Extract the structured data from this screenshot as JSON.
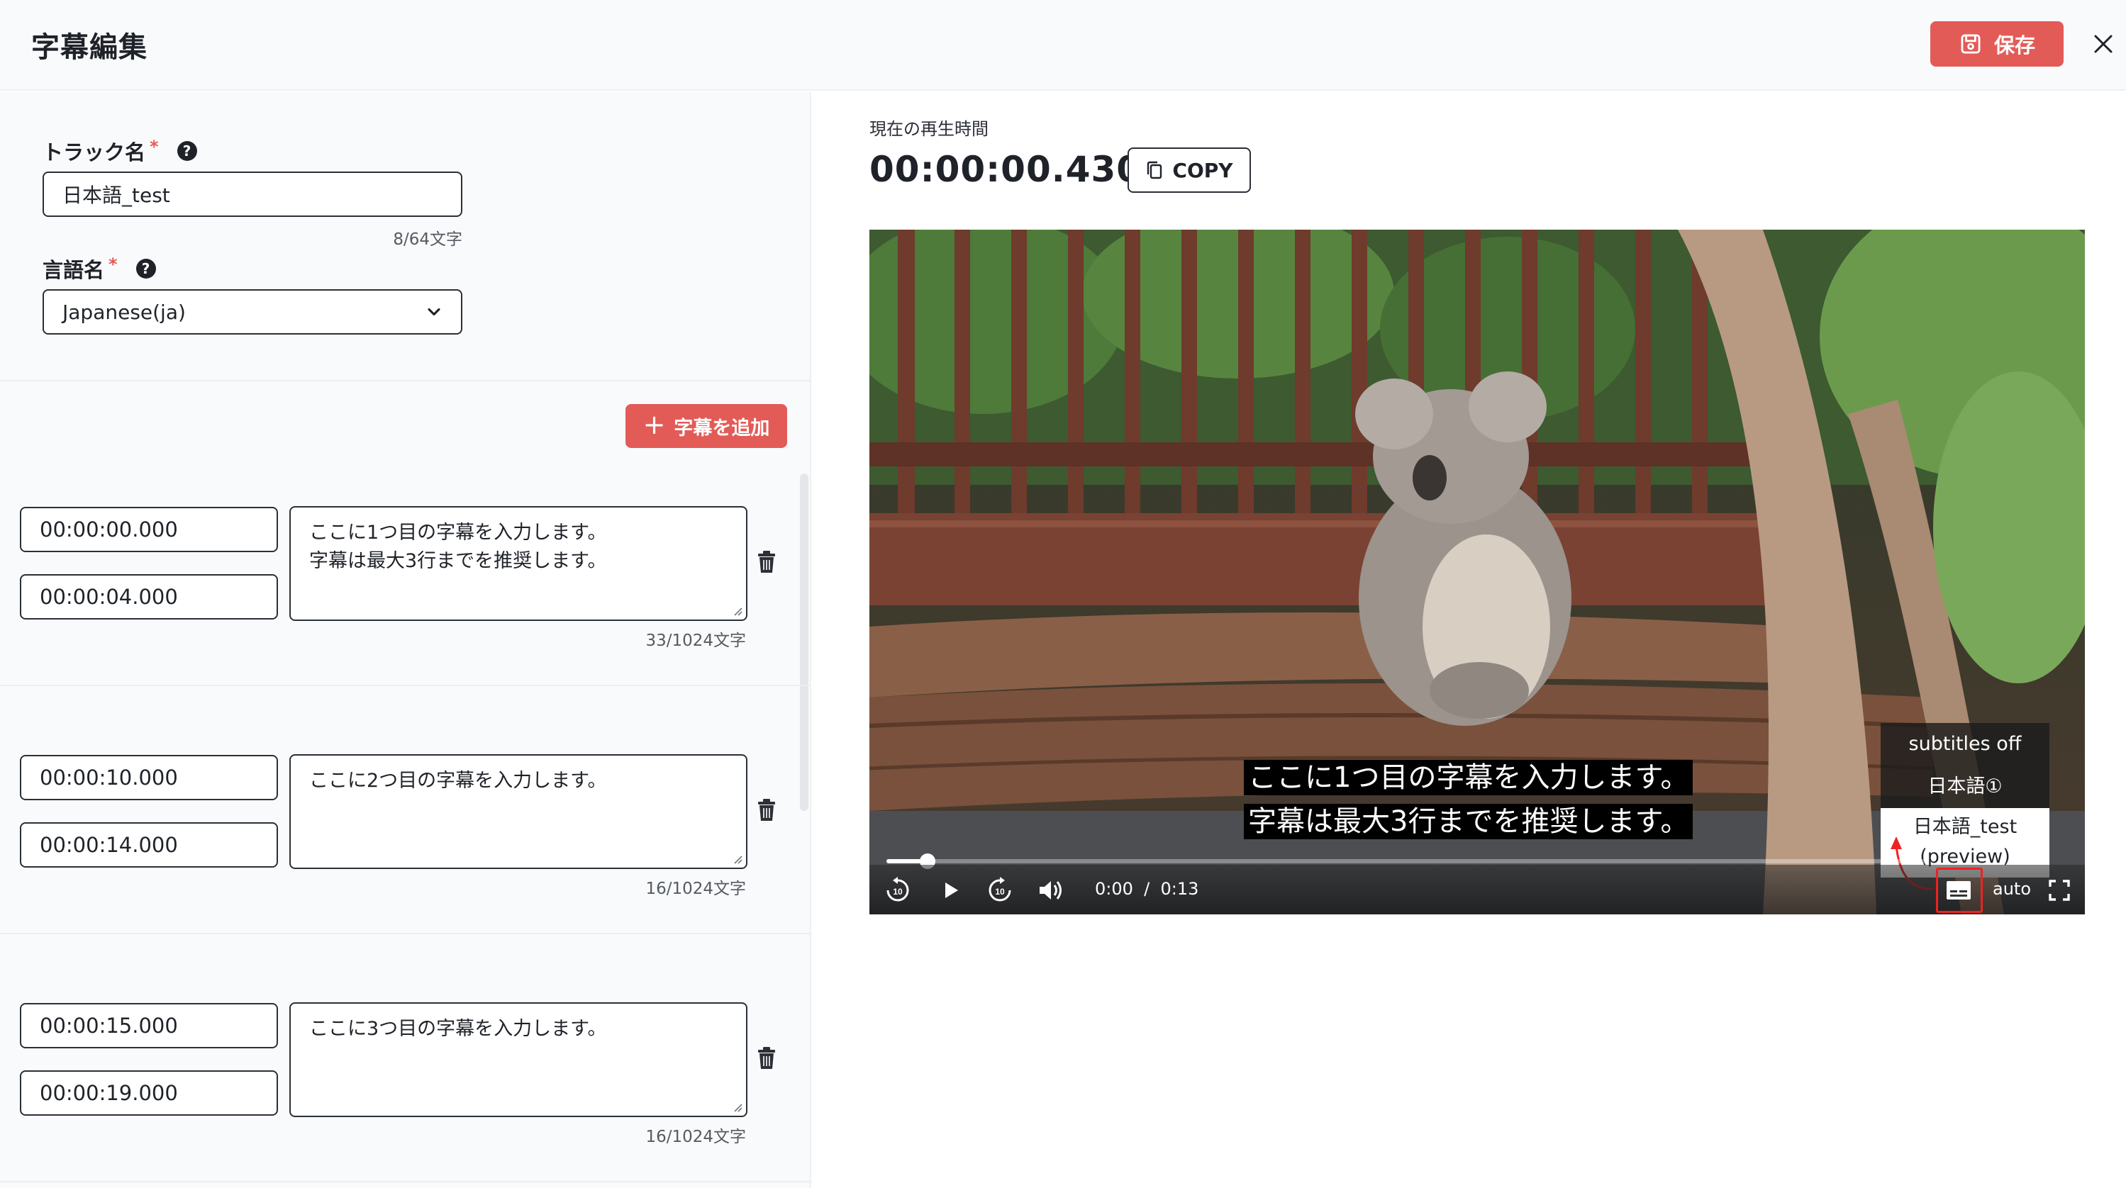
{
  "header": {
    "title": "字幕編集",
    "save_label": "保存"
  },
  "form": {
    "track_label": "トラック名",
    "track_required": "*",
    "track_value": "日本語_test",
    "track_counter": "8/64文字",
    "language_label": "言語名",
    "language_required": "*",
    "language_value": "Japanese(ja)",
    "help_glyph": "?"
  },
  "add_subtitle_label": "字幕を追加",
  "cues": [
    {
      "start": "00:00:00.000",
      "end": "00:00:04.000",
      "text": "ここに1つ目の字幕を入力します。\n字幕は最大3行までを推奨します。",
      "counter": "33/1024文字"
    },
    {
      "start": "00:00:10.000",
      "end": "00:00:14.000",
      "text": "ここに2つ目の字幕を入力します。",
      "counter": "16/1024文字"
    },
    {
      "start": "00:00:15.000",
      "end": "00:00:19.000",
      "text": "ここに3つ目の字幕を入力します。",
      "counter": "16/1024文字"
    }
  ],
  "player": {
    "current_time_label": "現在の再生時間",
    "current_time_value": "00:00:00.430",
    "copy_label": "COPY",
    "caption_line_1": "ここに1つ目の字幕を入力します。",
    "caption_line_2": "字幕は最大3行までを推奨します。",
    "time_current": "0:00",
    "time_separator": "/",
    "time_total": "0:13",
    "quality": "auto",
    "progress_fraction": 0.02,
    "subtitle_menu": {
      "off": "subtitles off",
      "track_1": "日本語①",
      "track_2_line_1": "日本語_test",
      "track_2_line_2": "(preview)"
    }
  },
  "colors": {
    "accent": "#e35b57",
    "highlight_border": "#e22222"
  },
  "icons": [
    "floppy-disk-icon",
    "close-icon",
    "help-icon",
    "chevron-down-icon",
    "plus-icon",
    "copy-icon",
    "trash-icon",
    "replay-10-icon",
    "play-icon",
    "forward-10-icon",
    "volume-icon",
    "subtitles-icon",
    "fullscreen-icon"
  ]
}
